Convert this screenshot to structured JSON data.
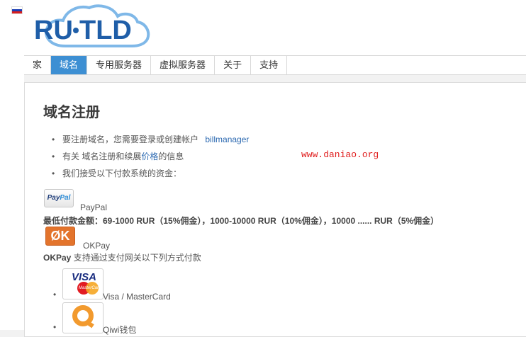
{
  "header": {
    "logo_text": "RU·TLD",
    "flag": "russia-flag"
  },
  "nav": {
    "items": [
      {
        "label": "家",
        "active": false
      },
      {
        "label": "域名",
        "active": true
      },
      {
        "label": "专用服务器",
        "active": false
      },
      {
        "label": "虚拟服务器",
        "active": false
      },
      {
        "label": "关于",
        "active": false
      },
      {
        "label": "支持",
        "active": false
      }
    ]
  },
  "main": {
    "title": "域名注册",
    "bullets": {
      "b1_text": "要注册域名，您需要登录或创建帐户",
      "b1_link": "billmanager",
      "b2_pre": "有关 域名注册和续展",
      "b2_link": "价格",
      "b2_post": "的信息",
      "b3_text": "我们接受以下付款系统的资金："
    },
    "watermark": "www.daniao.org",
    "paypal": {
      "logo_p1": "Pay",
      "logo_p2": "Pal",
      "name": "PayPal",
      "min_payment": "最低付款金额：69-1000 RUR（15%佣金），1000-10000 RUR（10%佣金），10000 ...... RUR（5%佣金）"
    },
    "okpay": {
      "logo": "ØK",
      "name": "OKPay",
      "desc_bold": "OKPay",
      "desc": " 支持通过支付网关以下列方式付款"
    },
    "methods": {
      "visa_logo": "VISA",
      "mc_logo": "MasterCard",
      "visa_name": "Visa / MasterCard",
      "qiwi_name": "Qiwi钱包"
    }
  },
  "colors": {
    "accent": "#3d8fd3",
    "link": "#2d6ab1",
    "watermark": "#e02020",
    "okpay": "#e3742c",
    "qiwi": "#f29a2e"
  }
}
